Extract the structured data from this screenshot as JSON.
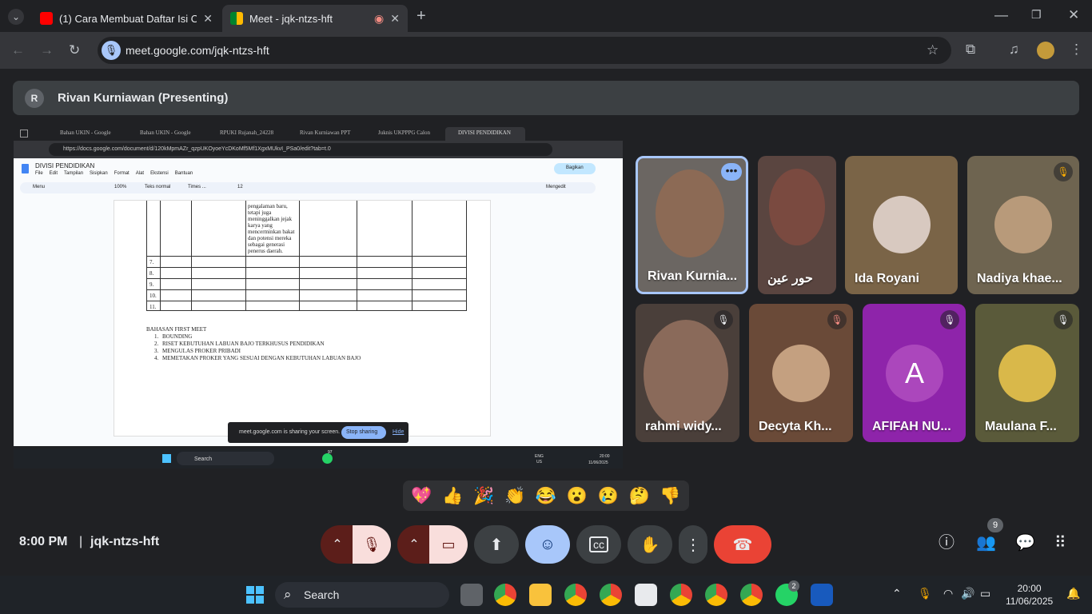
{
  "tabs": [
    {
      "title": "(1) Cara Membuat Daftar Isi Ot",
      "icon": "youtube-icon",
      "active": false
    },
    {
      "title": "Meet - jqk-ntzs-hft",
      "icon": "google-meet-icon",
      "active": true
    }
  ],
  "toolbar": {
    "url": "meet.google.com/jqk-ntzs-hft"
  },
  "presenter": {
    "avatar_letter": "R",
    "title": "Rivan Kurniawan (Presenting)"
  },
  "shared_screen": {
    "tabs": [
      "Bahan UKIN - Google",
      "Bahan UKIN - Google",
      "RPUKI Rujanah_24228",
      "Rivan Kurniawan PPT",
      "Juknis UKPPPG Calon",
      "DIVISI PENDIDIKAN"
    ],
    "url": "https://docs.google.com/document/d/120kMpmAZr_qzpUKOyoeYcDKoMf5Mf1XgxMUkvI_PSa0/edit?tab=t.0",
    "doc_title": "DIVISI PENDIDIKAN",
    "menu": [
      "File",
      "Edit",
      "Tampilan",
      "Sisipkan",
      "Format",
      "Alat",
      "Ekstensi",
      "Bantuan"
    ],
    "share_label": "Bagikan",
    "format_bar": {
      "menu": "Menu",
      "zoom": "100%",
      "style": "Teks normal",
      "font": "Times ...",
      "size": "12",
      "mode": "Mengedit"
    },
    "cell_text": [
      "pengalaman baru,",
      "tetapi juga",
      "meninggalkan jejak",
      "karya yang",
      "mencerminkan bakat",
      "dan potensi mereka",
      "sebagai generasi",
      "penerus daerah."
    ],
    "row_numbers": [
      "7.",
      "8.",
      "9.",
      "10.",
      "11."
    ],
    "heading": "BAHASAN FIRST MEET",
    "list": [
      {
        "n": "1.",
        "t": "BOUNDING"
      },
      {
        "n": "2.",
        "t": "RISET KEBUTUHAN LABUAN BAJO TERKHUSUS PENDIDIKAN"
      },
      {
        "n": "3.",
        "t": "MENGULAS PROKER PRIBADI"
      },
      {
        "n": "4.",
        "t": "MEMETAKAN PROKER YANG SESUAI DENGAN KEBUTUHAN LABUAN BAJO"
      }
    ],
    "sharing_notice": "meet.google.com is sharing your screen.",
    "stop_sharing": "Stop sharing",
    "hide": "Hide",
    "taskbar_search": "Search",
    "lang": "ENG",
    "region": "US",
    "time": "20:00",
    "date": "11/06/2025",
    "whatsapp_badge": "97"
  },
  "participants": [
    {
      "name": "Rivan Kurnia...",
      "muted": false,
      "speaking": true,
      "bg": "#6b6662"
    },
    {
      "name": "حور عين",
      "muted": false,
      "bg": "#5a4540"
    },
    {
      "name": "Ida Royani",
      "muted": false,
      "bg": "#7a6447"
    },
    {
      "name": "Nadiya khae...",
      "muted": true,
      "bg": "#6e6450"
    },
    {
      "name": "rahmi widy...",
      "muted": true,
      "bg": "#4a3f3a"
    },
    {
      "name": "Decyta Kh...",
      "muted": true,
      "bg": "#6a4a38"
    },
    {
      "name": "AFIFAH NU...",
      "muted": true,
      "bg": "#8e24aa",
      "avatar": "A"
    },
    {
      "name": "Maulana F...",
      "muted": true,
      "bg": "#5a5a3a"
    }
  ],
  "reactions": [
    "💖",
    "👍",
    "🎉",
    "👏",
    "😂",
    "😮",
    "😢",
    "🤔",
    "👎"
  ],
  "meeting": {
    "time": "8:00 PM",
    "separator": "|",
    "code": "jqk-ntzs-hft",
    "participant_count": "9"
  },
  "taskbar": {
    "search": "Search",
    "time": "20:00",
    "date": "11/06/2025",
    "whatsapp_badge": "2"
  },
  "colors": {
    "end_call": "#ea4335",
    "muted_ctrl": "#5c1e1a",
    "active_ctrl": "#a8c7fa",
    "ctrl": "#3c4043",
    "speaking_border": "#a8c7fa"
  }
}
